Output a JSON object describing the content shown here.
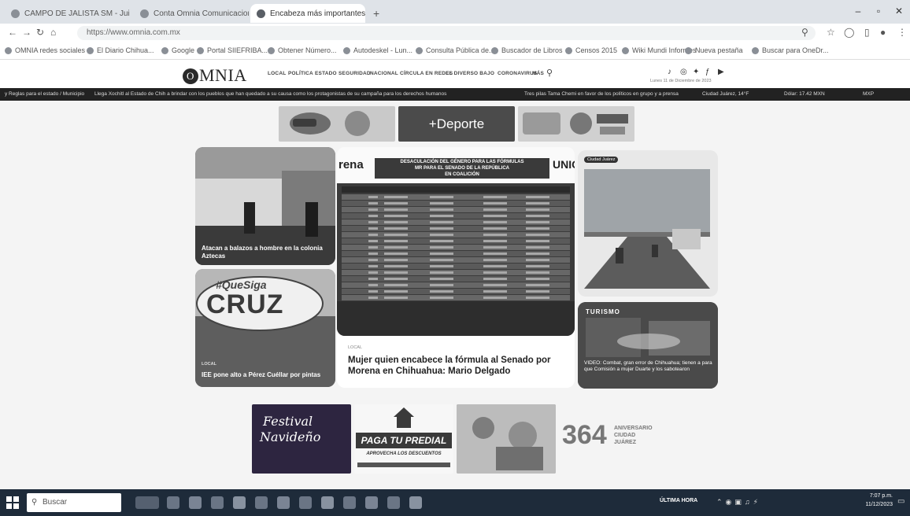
{
  "browser": {
    "tabs": [
      {
        "label": "CAMPO DE JALISTA SM - Jui"
      },
      {
        "label": "Conta Omnia Comunicacion..."
      },
      {
        "label": "Encabeza más importantes"
      }
    ],
    "new_tab": "+",
    "url": "https://www.omnia.com.mx",
    "bookmarks": [
      "OMNIA redes sociales",
      "El Diario Chihua...",
      "Google",
      "Portal SIIEFRIBA...",
      "Obtener Número...",
      "Autodeskel - Lun...",
      "Consulta Pública de...",
      "Buscador de Libros",
      "Censos 2015",
      "Wiki Mundi Informes",
      "Nueva pestaña",
      "Buscar para OneDr..."
    ]
  },
  "site": {
    "logo": "MNIA",
    "logo_initial": "O",
    "nav": [
      "LOCAL",
      "POLÍTICA",
      "ESTADO",
      "SEGURIDAD",
      "NACIONAL",
      "CÍRCULA EN REDES",
      "EL DIVERSO BAJO",
      "CORONAVIRUS",
      "MÁS"
    ],
    "tagline": "Lunes 11 de Diciembre de 2023",
    "ticker": [
      "y Reglas para el estado / Municipio",
      "Llega Xochitl al Estado de Chih a brindar con los pueblos que han quedado a su causa como los protagonistas de su campaña para los derechos humanos",
      "Tres pilas Tama Chemi en favor de los políticos en grupo y a prensa",
      "Ciudad Juárez, 14°F",
      "Dólar: 17.42 MXN",
      "MXP"
    ],
    "deporte_label": "+Deporte",
    "cards": {
      "top_left_caption": "Atacan a balazos a hombre en la colonia Aztecas",
      "bottom_left_caption": "IEE pone alto a Pérez Cuéllar por pintas",
      "bottom_left_tag": "LOCAL",
      "graffiti_hashtag": "#QueSiga",
      "graffiti_name": "CRUZ",
      "center_tag": "LOCAL",
      "center_headline": "Mujer quien encabece la fórmula al Senado por Morena en Chihuahua: Mario Delgado",
      "table_title_line1": "DESACULACIÓN DEL GÉNERO PARA LAS FÓRMULAS",
      "table_title_line2": "MR PARA EL SENADO DE LA REPÚBLICA",
      "table_title_line3": "EN COALICIÓN",
      "table_brand_left": "rena",
      "table_brand_right": "UNIC",
      "top_right_tag": "Ciudad Juárez",
      "bottom_right_title": "TURISMO",
      "bottom_right_caption": "VIDEO: Combat, gran error de Chihuahua; tienen a para que Comisión a mujer Duarte y los sabotearon"
    },
    "bottom_ads": {
      "festival_line1": "Festival",
      "festival_line2": "Navideño",
      "predial_title": "PAGA TU PREDIAL",
      "predial_sub": "APROVECHA LOS DESCUENTOS",
      "aniversario_num": "364",
      "aniversario_text": "ANIVERSARIO CIUDAD JUÁREZ"
    }
  },
  "taskbar": {
    "search_placeholder": "Buscar",
    "news": "ÚLTIMA HORA",
    "time": "7:07 p.m.",
    "date": "11/12/2023"
  },
  "colors": {
    "ticker_bg": "#222222",
    "deporte_bg": "#4b4b4b",
    "predial_red": "#c8303a",
    "festival_bg": "#2d2540"
  }
}
